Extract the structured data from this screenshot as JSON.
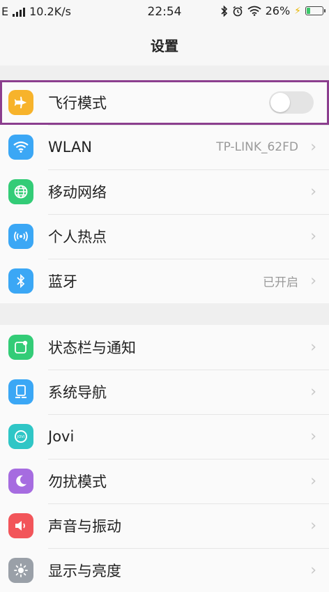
{
  "status_bar": {
    "network": "E",
    "speed": "10.2K/s",
    "time": "22:54",
    "battery_percent_text": "26%",
    "battery_level": 0.26
  },
  "header": {
    "title": "设置"
  },
  "group1": [
    {
      "label": "飞行模式",
      "icon": "airplane-icon",
      "color": "#f7b32b",
      "toggle": false
    },
    {
      "label": "WLAN",
      "icon": "wifi-icon",
      "color": "#3ba7f5",
      "value": "TP-LINK_62FD"
    },
    {
      "label": "移动网络",
      "icon": "globe-icon",
      "color": "#33cc77"
    },
    {
      "label": "个人热点",
      "icon": "hotspot-icon",
      "color": "#3ba7f5"
    },
    {
      "label": "蓝牙",
      "icon": "bluetooth-icon",
      "color": "#3ba7f5",
      "value": "已开启"
    }
  ],
  "group2": [
    {
      "label": "状态栏与通知",
      "icon": "notification-icon",
      "color": "#33cc77"
    },
    {
      "label": "系统导航",
      "icon": "navigation-icon",
      "color": "#3ba7f5"
    },
    {
      "label": "Jovi",
      "icon": "jovi-icon",
      "color": "#2fc6c6"
    },
    {
      "label": "勿扰模式",
      "icon": "moon-icon",
      "color": "#a66ce0"
    },
    {
      "label": "声音与振动",
      "icon": "speaker-icon",
      "color": "#f2555a"
    },
    {
      "label": "显示与亮度",
      "icon": "brightness-icon",
      "color": "#9aa0a8"
    }
  ],
  "chevron": "›"
}
